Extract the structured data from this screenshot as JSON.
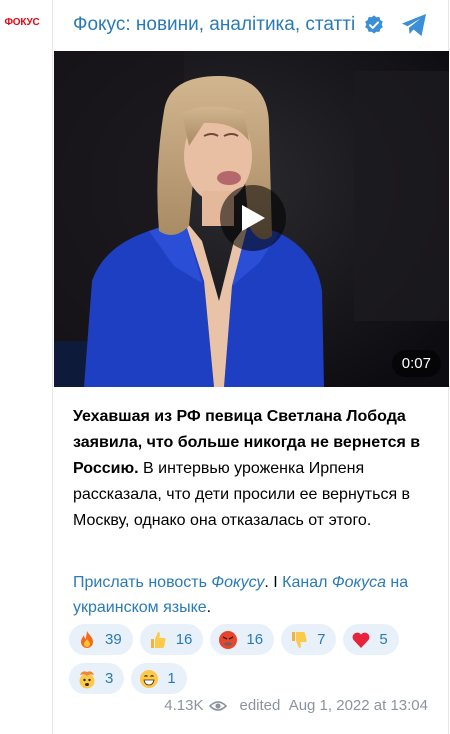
{
  "logo": {
    "text": "ФОКУС"
  },
  "channel": {
    "name": "Фокус: новини, аналітика, статті"
  },
  "video": {
    "duration": "0:07"
  },
  "message": {
    "bold": "Уехавшая из РФ певица Светлана Лобода заявила, что больше никогда не вернется в Россию.",
    "body": " В интервью уроженка Ирпеня рассказала, что дети просили ее вернуться в Москву, однако она отказалась от этого."
  },
  "links": {
    "send_news": "Прислать новость ",
    "send_news_italic": "Фокусу",
    "separator": ". I ",
    "channel_prefix": "Канал ",
    "channel_italic": "Фокуса",
    "channel_suffix": " на украинском языке",
    "end": "."
  },
  "reactions": [
    {
      "icon": "fire-emoji",
      "count": "39"
    },
    {
      "icon": "thumbs-up-emoji",
      "count": "16"
    },
    {
      "icon": "angry-face-emoji",
      "count": "16"
    },
    {
      "icon": "thumbs-down-emoji",
      "count": "7"
    },
    {
      "icon": "heart-emoji",
      "count": "5"
    },
    {
      "icon": "exploding-head-emoji",
      "count": "3"
    },
    {
      "icon": "grinning-face-emoji",
      "count": "1"
    }
  ],
  "footer": {
    "views": "4.13K",
    "edited": "edited",
    "date": "Aug 1, 2022 at 13:04"
  },
  "colors": {
    "accent": "#2a7ab8",
    "brand_red": "#e30613",
    "blazer": "#1f3fc2"
  }
}
